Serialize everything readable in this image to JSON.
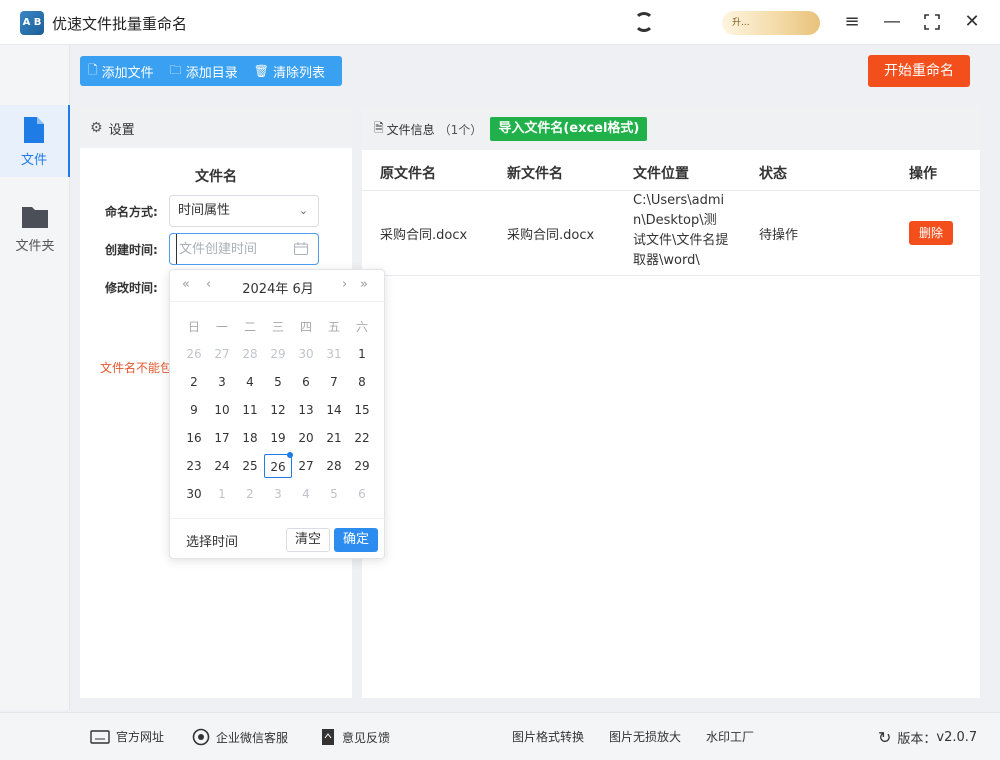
{
  "app": {
    "logo_text": "A B",
    "title": "优速文件批量重命名",
    "vip_text": "升..."
  },
  "sidebar": {
    "items": [
      {
        "label": "文件",
        "icon": "file-icon",
        "active": true
      },
      {
        "label": "文件夹",
        "icon": "folder-icon",
        "active": false
      }
    ]
  },
  "toolbar": {
    "add_file": "添加文件",
    "add_dir": "添加目录",
    "clear_list": "清除列表",
    "start_rename": "开始重命名"
  },
  "settings": {
    "header": "设置",
    "section_title": "文件名",
    "naming_label": "命名方式:",
    "naming_value": "时间属性",
    "created_label": "创建时间:",
    "created_placeholder": "文件创建时间",
    "modified_label": "修改时间:",
    "warning": "文件名不能包"
  },
  "datepicker": {
    "title": "2024年 6月",
    "weekdays": [
      "日",
      "一",
      "二",
      "三",
      "四",
      "五",
      "六"
    ],
    "weeks": [
      [
        "26",
        "27",
        "28",
        "29",
        "30",
        "31",
        "1"
      ],
      [
        "2",
        "3",
        "4",
        "5",
        "6",
        "7",
        "8"
      ],
      [
        "9",
        "10",
        "11",
        "12",
        "13",
        "14",
        "15"
      ],
      [
        "16",
        "17",
        "18",
        "19",
        "20",
        "21",
        "22"
      ],
      [
        "23",
        "24",
        "25",
        "26",
        "27",
        "28",
        "29"
      ],
      [
        "30",
        "1",
        "2",
        "3",
        "4",
        "5",
        "6"
      ]
    ],
    "today": "26",
    "select_time": "选择时间",
    "clear": "清空",
    "confirm": "确定"
  },
  "files": {
    "header": "文件信息",
    "count": "（1个）",
    "import_btn": "导入文件名(excel格式)",
    "columns": [
      "原文件名",
      "新文件名",
      "文件位置",
      "状态",
      "操作"
    ],
    "rows": [
      {
        "original": "采购合同.docx",
        "new_name": "采购合同.docx",
        "location": "C:\\Users\\admin\\Desktop\\测试文件\\文件名提取器\\word\\",
        "status": "待操作",
        "action": "删除"
      }
    ]
  },
  "footer": {
    "website": "官方网址",
    "wechat": "企业微信客服",
    "feedback": "意见反馈",
    "img_convert": "图片格式转换",
    "img_enlarge": "图片无损放大",
    "watermark": "水印工厂",
    "version_label": "版本：",
    "version": "v2.0.7"
  },
  "colors": {
    "primary": "#1f7ce6",
    "toolbar": "#3aa0f2",
    "accent_red": "#f24f1d",
    "import_green": "#21b14a"
  }
}
